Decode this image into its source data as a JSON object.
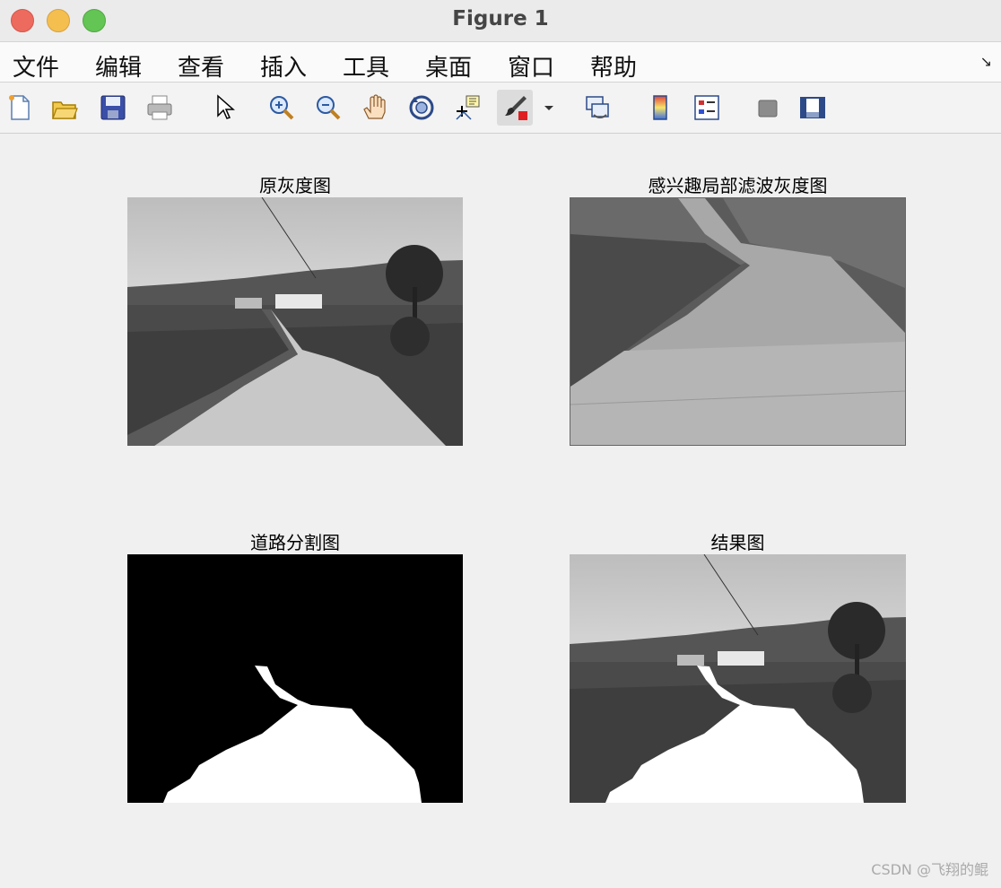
{
  "window": {
    "title": "Figure 1"
  },
  "menu": [
    "文件",
    "编辑",
    "查看",
    "插入",
    "工具",
    "桌面",
    "窗口",
    "帮助"
  ],
  "toolbar_icons": [
    "new-figure-icon",
    "open-file-icon",
    "save-icon",
    "print-icon",
    "select-pointer-icon",
    "zoom-in-icon",
    "zoom-out-icon",
    "pan-hand-icon",
    "rotate-3d-icon",
    "data-cursor-icon",
    "brush-icon",
    "brush-dropdown-icon",
    "link-plot-icon",
    "colorbar-icon",
    "legend-icon",
    "hide-plot-tools-icon",
    "show-plot-tools-icon"
  ],
  "subplots": [
    {
      "title": "原灰度图"
    },
    {
      "title": "感兴趣局部滤波灰度图"
    },
    {
      "title": "道路分割图"
    },
    {
      "title": "结果图"
    }
  ],
  "watermark": "CSDN @飞翔的鲲"
}
